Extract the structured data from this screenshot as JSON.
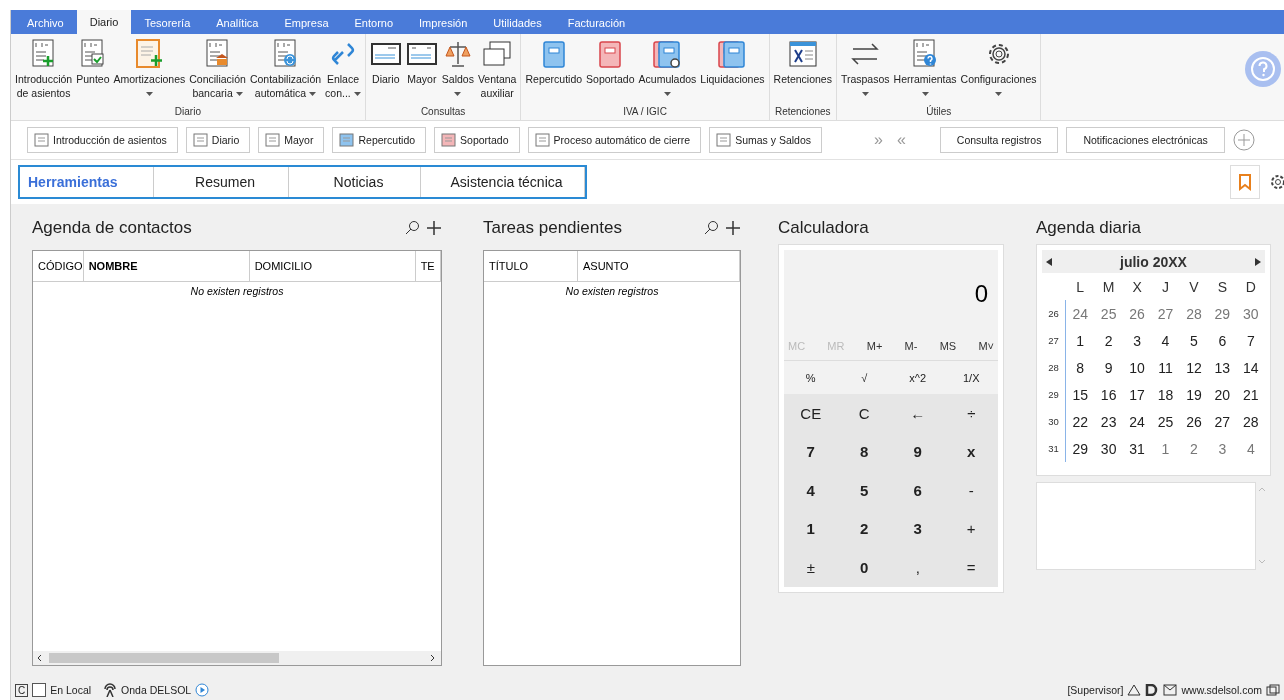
{
  "menu_tabs": [
    {
      "label": "Archivo",
      "selected": false
    },
    {
      "label": "Diario",
      "selected": true
    },
    {
      "label": "Tesorería",
      "selected": false
    },
    {
      "label": "Analítica",
      "selected": false
    },
    {
      "label": "Empresa",
      "selected": false
    },
    {
      "label": "Entorno",
      "selected": false
    },
    {
      "label": "Impresión",
      "selected": false
    },
    {
      "label": "Utilidades",
      "selected": false
    },
    {
      "label": "Facturación",
      "selected": false
    }
  ],
  "ribbon": {
    "groups": [
      {
        "label": "Diario",
        "items": [
          {
            "lines": [
              "Introducción",
              "de asientos"
            ],
            "dropdown": false
          },
          {
            "lines": [
              "Punteo"
            ],
            "dropdown": false
          },
          {
            "lines": [
              "Amortizaciones"
            ],
            "dropdown": true
          },
          {
            "lines": [
              "Conciliación",
              "bancaria"
            ],
            "dropdown": true
          },
          {
            "lines": [
              "Contabilización",
              "automática"
            ],
            "dropdown": true
          },
          {
            "lines": [
              "Enlace",
              "con..."
            ],
            "dropdown": true
          }
        ]
      },
      {
        "label": "Consultas",
        "items": [
          {
            "lines": [
              "Diario"
            ],
            "dropdown": false
          },
          {
            "lines": [
              "Mayor"
            ],
            "dropdown": false
          },
          {
            "lines": [
              "Saldos"
            ],
            "dropdown": true
          },
          {
            "lines": [
              "Ventana",
              "auxiliar"
            ],
            "dropdown": false
          }
        ]
      },
      {
        "label": "IVA / IGIC",
        "items": [
          {
            "lines": [
              "Repercutido"
            ],
            "dropdown": false
          },
          {
            "lines": [
              "Soportado"
            ],
            "dropdown": false
          },
          {
            "lines": [
              "Acumulados"
            ],
            "dropdown": true
          },
          {
            "lines": [
              "Liquidaciones"
            ],
            "dropdown": false
          }
        ]
      },
      {
        "label": "Retenciones",
        "items": [
          {
            "lines": [
              "Retenciones"
            ],
            "dropdown": false
          }
        ]
      },
      {
        "label": "Útiles",
        "items": [
          {
            "lines": [
              "Traspasos"
            ],
            "dropdown": true
          },
          {
            "lines": [
              "Herramientas"
            ],
            "dropdown": true
          },
          {
            "lines": [
              "Configuraciones"
            ],
            "dropdown": true
          }
        ]
      }
    ]
  },
  "quick_bar": {
    "buttons": [
      "Introducción de asientos",
      "Diario",
      "Mayor",
      "Repercutido",
      "Soportado",
      "Proceso automático de cierre",
      "Sumas y Saldos"
    ],
    "scroll_right": "»",
    "scroll_left": "«",
    "right_buttons": [
      "Consulta registros",
      "Notificaciones electrónicas"
    ]
  },
  "panel_tabs": [
    {
      "label": "Herramientas",
      "selected": true
    },
    {
      "label": "Resumen",
      "selected": false
    },
    {
      "label": "Noticias",
      "selected": false
    },
    {
      "label": "Asistencia técnica",
      "selected": false
    }
  ],
  "contacts": {
    "title": "Agenda de contactos",
    "columns": [
      "CÓDIGO",
      "NOMBRE",
      "DOMICILIO",
      "TE"
    ],
    "empty": "No existen registros"
  },
  "tasks": {
    "title": "Tareas pendientes",
    "columns": [
      "TÍTULO",
      "ASUNTO"
    ],
    "empty": "No existen registros"
  },
  "calculator": {
    "title": "Calculadora",
    "display": "0",
    "memory": [
      {
        "label": "MC",
        "disabled": true
      },
      {
        "label": "MR",
        "disabled": true
      },
      {
        "label": "M+",
        "disabled": false
      },
      {
        "label": "M-",
        "disabled": false
      },
      {
        "label": "MS",
        "disabled": false
      },
      {
        "label": "M˅",
        "disabled": false
      }
    ],
    "rows": [
      [
        {
          "label": "%",
          "kind": "function"
        },
        {
          "label": "√",
          "kind": "function"
        },
        {
          "label": "x^2",
          "kind": "function"
        },
        {
          "label": "1/X",
          "kind": "function"
        }
      ],
      [
        {
          "label": "CE",
          "kind": "op"
        },
        {
          "label": "C",
          "kind": "op"
        },
        {
          "label": "←",
          "kind": "op"
        },
        {
          "label": "÷",
          "kind": "op"
        }
      ],
      [
        {
          "label": "7",
          "kind": "digit"
        },
        {
          "label": "8",
          "kind": "digit"
        },
        {
          "label": "9",
          "kind": "digit"
        },
        {
          "label": "x",
          "kind": "digit"
        }
      ],
      [
        {
          "label": "4",
          "kind": "digit"
        },
        {
          "label": "5",
          "kind": "digit"
        },
        {
          "label": "6",
          "kind": "digit"
        },
        {
          "label": "-",
          "kind": "op"
        }
      ],
      [
        {
          "label": "1",
          "kind": "digit"
        },
        {
          "label": "2",
          "kind": "digit"
        },
        {
          "label": "3",
          "kind": "digit"
        },
        {
          "label": "+",
          "kind": "op"
        }
      ],
      [
        {
          "label": "±",
          "kind": "op"
        },
        {
          "label": "0",
          "kind": "digit"
        },
        {
          "label": ",",
          "kind": "op"
        },
        {
          "label": "=",
          "kind": "op"
        }
      ]
    ]
  },
  "agenda": {
    "title": "Agenda diaria",
    "month": "julio 20XX",
    "weekdays": [
      "L",
      "M",
      "X",
      "J",
      "V",
      "S",
      "D"
    ],
    "weeks": [
      {
        "week": "26",
        "days": [
          {
            "day": "24",
            "other_month": true
          },
          {
            "day": "25",
            "other_month": true
          },
          {
            "day": "26",
            "other_month": true
          },
          {
            "day": "27",
            "other_month": true
          },
          {
            "day": "28",
            "other_month": true
          },
          {
            "day": "29",
            "other_month": true
          },
          {
            "day": "30",
            "other_month": true
          }
        ]
      },
      {
        "week": "27",
        "days": [
          {
            "day": "1",
            "other_month": false
          },
          {
            "day": "2",
            "other_month": false
          },
          {
            "day": "3",
            "other_month": false
          },
          {
            "day": "4",
            "other_month": false
          },
          {
            "day": "5",
            "other_month": false
          },
          {
            "day": "6",
            "other_month": false
          },
          {
            "day": "7",
            "other_month": false
          }
        ]
      },
      {
        "week": "28",
        "days": [
          {
            "day": "8",
            "other_month": false
          },
          {
            "day": "9",
            "other_month": false
          },
          {
            "day": "10",
            "other_month": false
          },
          {
            "day": "11",
            "other_month": false
          },
          {
            "day": "12",
            "other_month": false
          },
          {
            "day": "13",
            "other_month": false
          },
          {
            "day": "14",
            "other_month": false
          }
        ]
      },
      {
        "week": "29",
        "days": [
          {
            "day": "15",
            "other_month": false
          },
          {
            "day": "16",
            "other_month": false
          },
          {
            "day": "17",
            "other_month": false
          },
          {
            "day": "18",
            "other_month": false
          },
          {
            "day": "19",
            "other_month": false
          },
          {
            "day": "20",
            "other_month": false
          },
          {
            "day": "21",
            "other_month": false
          }
        ]
      },
      {
        "week": "30",
        "days": [
          {
            "day": "22",
            "other_month": false
          },
          {
            "day": "23",
            "other_month": false
          },
          {
            "day": "24",
            "other_month": false
          },
          {
            "day": "25",
            "other_month": false
          },
          {
            "day": "26",
            "other_month": false
          },
          {
            "day": "27",
            "other_month": false
          },
          {
            "day": "28",
            "other_month": false
          }
        ]
      },
      {
        "week": "31",
        "days": [
          {
            "day": "29",
            "other_month": false
          },
          {
            "day": "30",
            "other_month": false
          },
          {
            "day": "31",
            "other_month": false
          },
          {
            "day": "1",
            "other_month": true
          },
          {
            "day": "2",
            "other_month": true
          },
          {
            "day": "3",
            "other_month": true
          },
          {
            "day": "4",
            "other_month": true
          }
        ]
      }
    ]
  },
  "status_bar": {
    "mode_key": "C",
    "local_label": "En Local",
    "local_checked": false,
    "radio_label": "Onda DELSOL",
    "user": "[Supervisor]",
    "website": "www.sdelsol.com"
  }
}
